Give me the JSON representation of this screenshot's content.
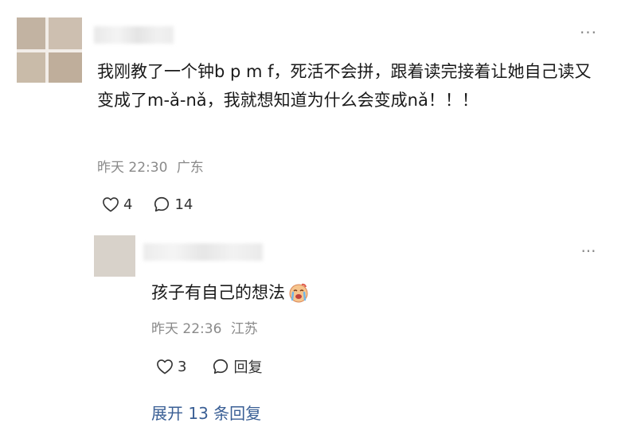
{
  "comment": {
    "more_label": "···",
    "text": "我刚教了一个钟b p m f，死活不会拼，跟着读完接着让她自己读又变成了m-ǎ-nǎ，我就想知道为什么会变成nǎ！！！",
    "time": "昨天 22:30",
    "location": "广东",
    "likes": "4",
    "comments": "14"
  },
  "reply": {
    "more_label": "···",
    "text": "孩子有自己的想法",
    "emoji_icon": "crying-face-emoji-icon",
    "time": "昨天 22:36",
    "location": "江苏",
    "likes": "3",
    "reply_label": "回复"
  },
  "expand": {
    "label": "展开 13 条回复"
  },
  "colors": {
    "link_blue": "#3a5f95",
    "meta_gray": "#8a8a8a",
    "text_dark": "#1a1a1a"
  }
}
